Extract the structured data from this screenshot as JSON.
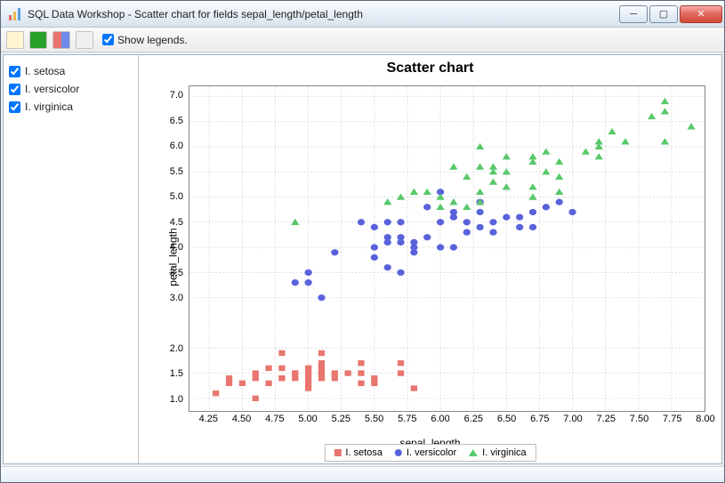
{
  "window": {
    "title": "SQL Data Workshop - Scatter chart for fields sepal_length/petal_length"
  },
  "toolbar": {
    "show_legends_label": "Show legends."
  },
  "sidebar": {
    "items": [
      {
        "label": "I. setosa",
        "checked": true
      },
      {
        "label": "I. versicolor",
        "checked": true
      },
      {
        "label": "I. virginica",
        "checked": true
      }
    ]
  },
  "chart_data": {
    "type": "scatter",
    "title": "Scatter chart",
    "xlabel": "sepal_length",
    "ylabel": "petal_length",
    "xlim": [
      4.1,
      8.0
    ],
    "ylim": [
      0.75,
      7.2
    ],
    "xticks": [
      4.25,
      4.5,
      4.75,
      5.0,
      5.25,
      5.5,
      5.75,
      6.0,
      6.25,
      6.5,
      6.75,
      7.0,
      7.25,
      7.5,
      7.75,
      8.0
    ],
    "yticks": [
      1.0,
      1.5,
      2.0,
      3.0,
      3.5,
      4.0,
      4.5,
      5.0,
      5.5,
      6.0,
      6.5,
      7.0
    ],
    "legend": [
      "I. setosa",
      "I. versicolor",
      "I. virginica"
    ],
    "series": [
      {
        "name": "I. setosa",
        "marker": "square",
        "color": "#e8756e",
        "points": [
          [
            4.3,
            1.1
          ],
          [
            4.4,
            1.4
          ],
          [
            4.4,
            1.3
          ],
          [
            4.5,
            1.3
          ],
          [
            4.6,
            1.0
          ],
          [
            4.6,
            1.5
          ],
          [
            4.6,
            1.4
          ],
          [
            4.7,
            1.3
          ],
          [
            4.7,
            1.6
          ],
          [
            4.8,
            1.6
          ],
          [
            4.8,
            1.9
          ],
          [
            4.8,
            1.4
          ],
          [
            4.8,
            1.4
          ],
          [
            4.9,
            1.5
          ],
          [
            4.9,
            1.4
          ],
          [
            4.9,
            1.5
          ],
          [
            5.0,
            1.2
          ],
          [
            5.0,
            1.6
          ],
          [
            5.0,
            1.4
          ],
          [
            5.0,
            1.3
          ],
          [
            5.0,
            1.5
          ],
          [
            5.0,
            1.6
          ],
          [
            5.1,
            1.9
          ],
          [
            5.1,
            1.5
          ],
          [
            5.1,
            1.4
          ],
          [
            5.1,
            1.7
          ],
          [
            5.1,
            1.6
          ],
          [
            5.1,
            1.5
          ],
          [
            5.2,
            1.5
          ],
          [
            5.2,
            1.4
          ],
          [
            5.3,
            1.5
          ],
          [
            5.4,
            1.7
          ],
          [
            5.4,
            1.5
          ],
          [
            5.4,
            1.3
          ],
          [
            5.5,
            1.4
          ],
          [
            5.5,
            1.3
          ],
          [
            5.7,
            1.5
          ],
          [
            5.7,
            1.7
          ],
          [
            5.8,
            1.2
          ]
        ]
      },
      {
        "name": "I. versicolor",
        "marker": "circle",
        "color": "#5a62db",
        "points": [
          [
            4.9,
            3.3
          ],
          [
            5.0,
            3.3
          ],
          [
            5.0,
            3.5
          ],
          [
            5.1,
            3.0
          ],
          [
            5.2,
            3.9
          ],
          [
            5.4,
            4.5
          ],
          [
            5.5,
            4.0
          ],
          [
            5.5,
            3.8
          ],
          [
            5.5,
            4.4
          ],
          [
            5.6,
            3.6
          ],
          [
            5.6,
            4.2
          ],
          [
            5.6,
            4.5
          ],
          [
            5.6,
            4.1
          ],
          [
            5.7,
            4.2
          ],
          [
            5.7,
            4.1
          ],
          [
            5.7,
            4.5
          ],
          [
            5.7,
            3.5
          ],
          [
            5.8,
            4.0
          ],
          [
            5.8,
            4.1
          ],
          [
            5.8,
            3.9
          ],
          [
            5.9,
            4.2
          ],
          [
            5.9,
            4.8
          ],
          [
            6.0,
            4.0
          ],
          [
            6.0,
            4.5
          ],
          [
            6.0,
            5.1
          ],
          [
            6.1,
            4.0
          ],
          [
            6.1,
            4.7
          ],
          [
            6.1,
            4.6
          ],
          [
            6.2,
            4.3
          ],
          [
            6.2,
            4.5
          ],
          [
            6.3,
            4.4
          ],
          [
            6.3,
            4.9
          ],
          [
            6.3,
            4.7
          ],
          [
            6.4,
            4.5
          ],
          [
            6.4,
            4.3
          ],
          [
            6.5,
            4.6
          ],
          [
            6.6,
            4.4
          ],
          [
            6.6,
            4.6
          ],
          [
            6.7,
            4.7
          ],
          [
            6.7,
            4.4
          ],
          [
            6.8,
            4.8
          ],
          [
            6.9,
            4.9
          ],
          [
            7.0,
            4.7
          ]
        ]
      },
      {
        "name": "I. virginica",
        "marker": "triangle",
        "color": "#58c96a",
        "points": [
          [
            4.9,
            4.5
          ],
          [
            5.6,
            4.9
          ],
          [
            5.7,
            5.0
          ],
          [
            5.8,
            5.1
          ],
          [
            5.8,
            5.1
          ],
          [
            5.9,
            5.1
          ],
          [
            6.0,
            5.0
          ],
          [
            6.0,
            4.8
          ],
          [
            6.1,
            4.9
          ],
          [
            6.1,
            5.6
          ],
          [
            6.2,
            5.4
          ],
          [
            6.2,
            4.8
          ],
          [
            6.3,
            5.6
          ],
          [
            6.3,
            5.1
          ],
          [
            6.3,
            6.0
          ],
          [
            6.3,
            4.9
          ],
          [
            6.4,
            5.6
          ],
          [
            6.4,
            5.5
          ],
          [
            6.4,
            5.3
          ],
          [
            6.5,
            5.8
          ],
          [
            6.5,
            5.5
          ],
          [
            6.5,
            5.2
          ],
          [
            6.7,
            5.2
          ],
          [
            6.7,
            5.7
          ],
          [
            6.7,
            5.8
          ],
          [
            6.7,
            5.0
          ],
          [
            6.8,
            5.5
          ],
          [
            6.8,
            5.9
          ],
          [
            6.9,
            5.4
          ],
          [
            6.9,
            5.1
          ],
          [
            6.9,
            5.7
          ],
          [
            7.1,
            5.9
          ],
          [
            7.2,
            6.0
          ],
          [
            7.2,
            5.8
          ],
          [
            7.2,
            6.1
          ],
          [
            7.3,
            6.3
          ],
          [
            7.4,
            6.1
          ],
          [
            7.6,
            6.6
          ],
          [
            7.7,
            6.7
          ],
          [
            7.7,
            6.9
          ],
          [
            7.7,
            6.1
          ],
          [
            7.9,
            6.4
          ]
        ]
      }
    ]
  }
}
